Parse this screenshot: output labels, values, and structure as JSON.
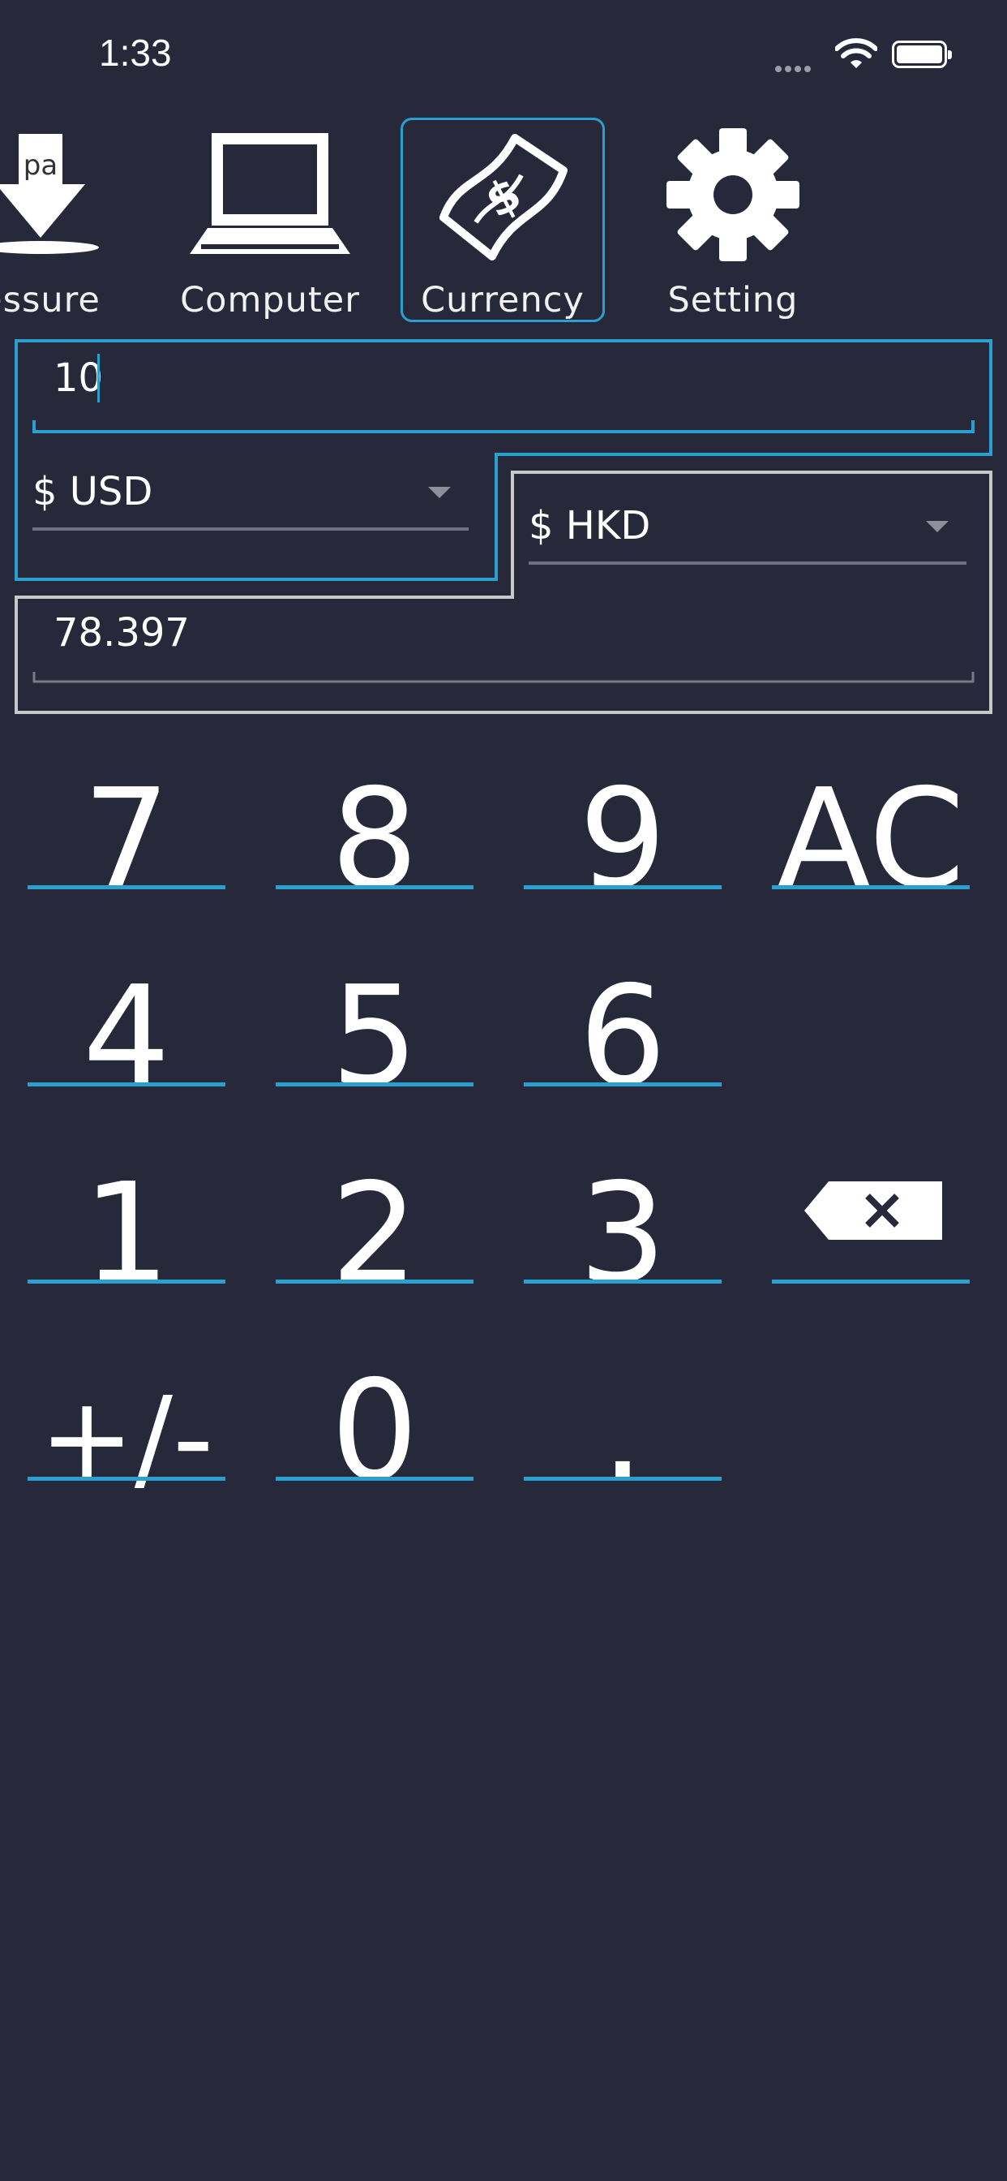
{
  "status_bar": {
    "time": "1:33"
  },
  "tabs": [
    {
      "label": "essure",
      "icon": "pressure-icon",
      "icon_text": "pa"
    },
    {
      "label": "Computer",
      "icon": "laptop-icon"
    },
    {
      "label": "Currency",
      "icon": "money-bill-icon",
      "selected": true
    },
    {
      "label": "Setting",
      "icon": "gear-icon"
    }
  ],
  "converter": {
    "amount": "10",
    "from_currency": "$ USD",
    "to_currency": "$ HKD",
    "result": "78.397"
  },
  "keypad": {
    "rows": [
      [
        "7",
        "8",
        "9",
        "AC"
      ],
      [
        "4",
        "5",
        "6",
        ""
      ],
      [
        "1",
        "2",
        "3",
        "backspace"
      ],
      [
        "+/-",
        "0",
        ".",
        ""
      ]
    ]
  },
  "colors": {
    "background": "#272839",
    "accent": "#2aa0d0",
    "frame_gray": "#c8c8c8"
  }
}
